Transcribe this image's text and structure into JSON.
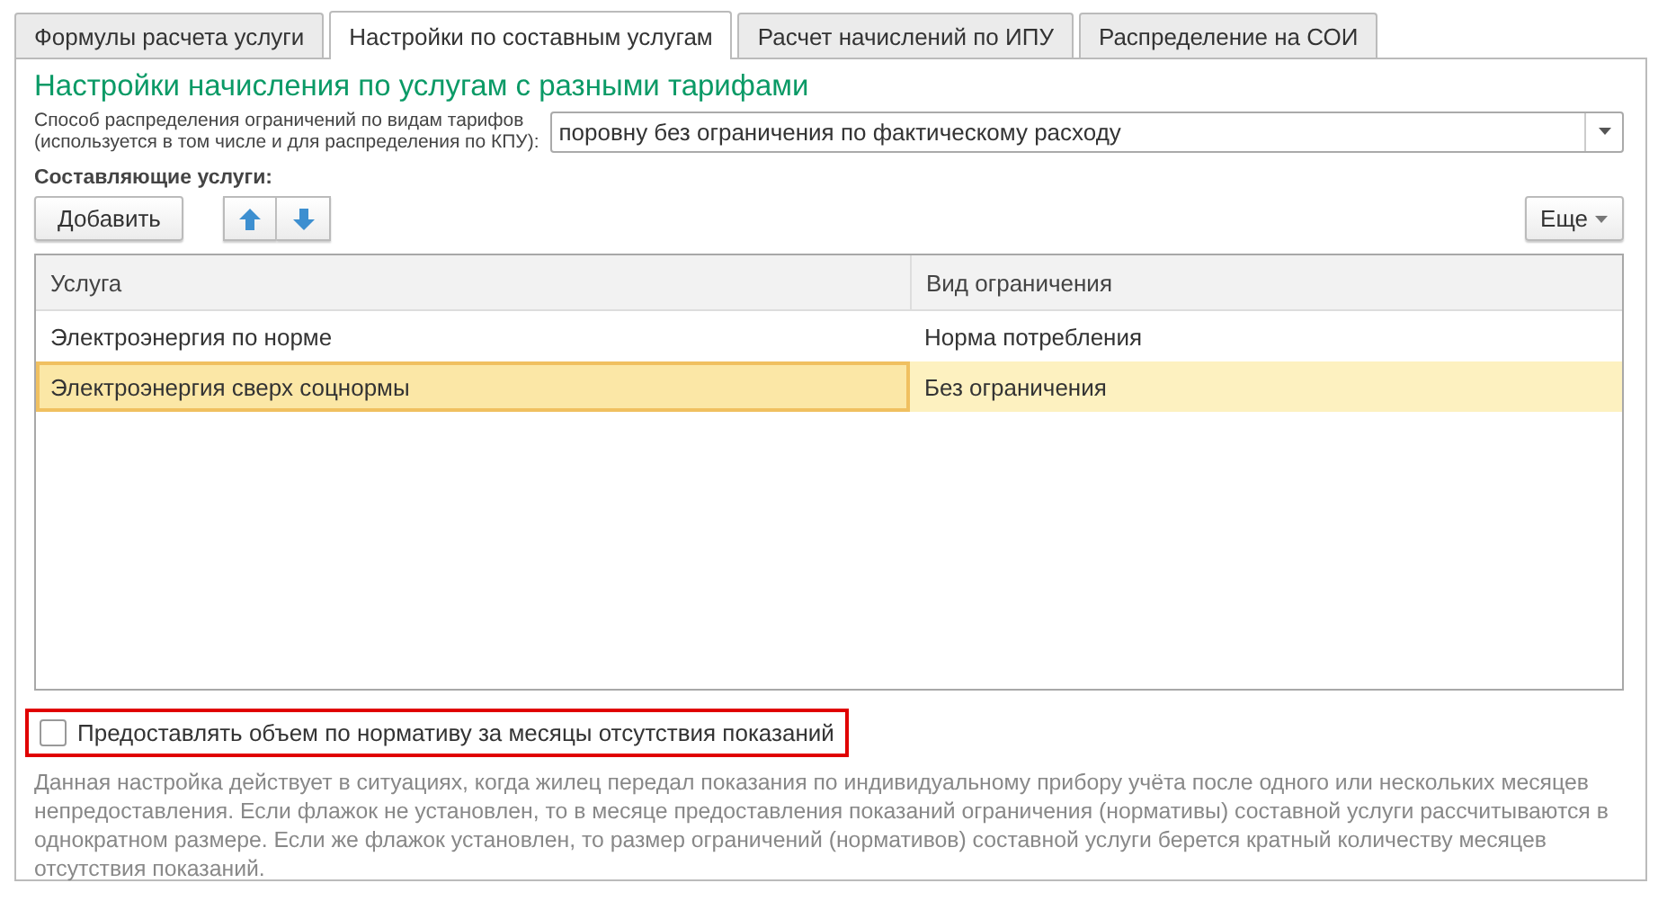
{
  "tabs": [
    {
      "label": "Формулы расчета услуги",
      "selected": false
    },
    {
      "label": "Настройки по составным услугам",
      "selected": true
    },
    {
      "label": "Расчет начислений по ИПУ",
      "selected": false
    },
    {
      "label": "Распределение на СОИ",
      "selected": false
    }
  ],
  "section_title": "Настройки начисления по услугам с разными тарифами",
  "distribution": {
    "label_lines": [
      "Способ распределения ограничений по видам тарифов",
      "(используется в том числе и для распределения по КПУ):"
    ],
    "value": "поровну без ограничения по фактическому расходу"
  },
  "components": {
    "title": "Составляющие услуги:",
    "add_button": "Добавить",
    "more_button": "Еще",
    "table": {
      "columns": [
        "Услуга",
        "Вид ограничения"
      ],
      "rows": [
        {
          "cells": [
            "Электроэнергия по норме",
            "Норма потребления"
          ],
          "selected": false
        },
        {
          "cells": [
            "Электроэнергия сверх соцнормы",
            "Без ограничения"
          ],
          "selected": true
        }
      ]
    }
  },
  "checkbox": {
    "label": "Предоставлять объем по нормативу за месяцы отсутствия показаний",
    "checked": false,
    "highlighted": true
  },
  "note": "Данная настройка действует в ситуациях, когда жилец передал показания по индивидуальному прибору учёта после одного или нескольких месяцев непредоставления. Если флажок не установлен, то в месяце предоставления показаний ограничения (нормативы) составной услуги рассчитываются в однократном размере. Если же флажок установлен, то размер ограничений (нормативов) составной услуги берется кратный количеству месяцев отсутствия показаний."
}
